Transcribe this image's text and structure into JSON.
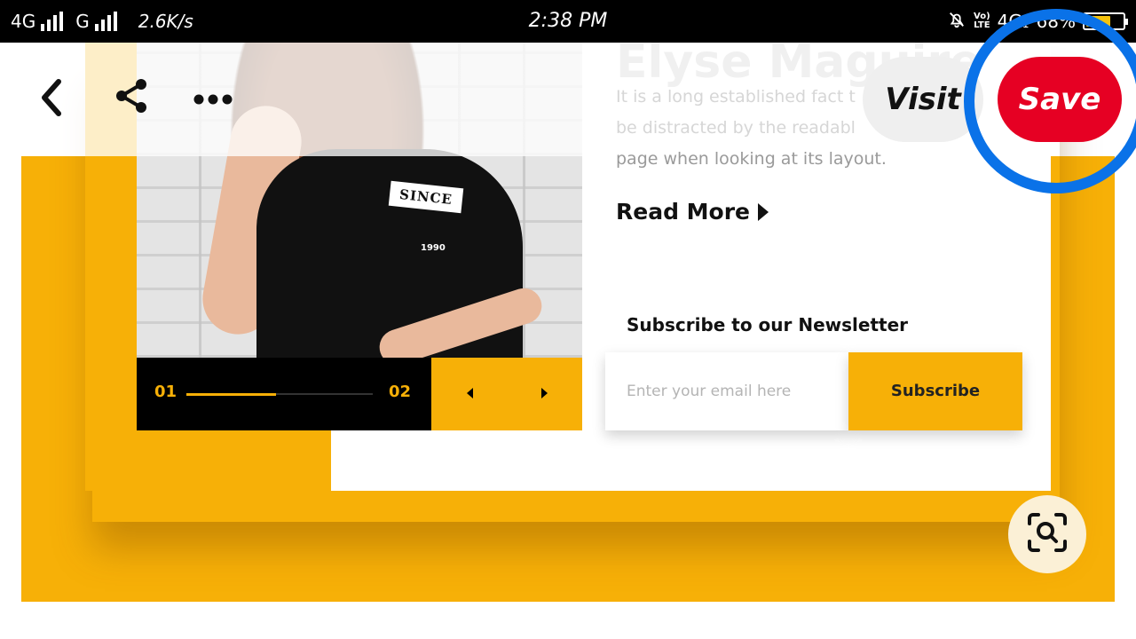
{
  "status_bar": {
    "network1": "4G",
    "network2": "G",
    "speed": "2.6K/s",
    "time": "2:38 PM",
    "volte_top": "Vo)",
    "volte_bottom": "LTE",
    "network3": "4G",
    "network3_sub": "1",
    "battery": "68%",
    "battery_level": 0.68,
    "mute_icon": "bell-slash-icon"
  },
  "toolbar": {
    "back_icon": "chevron-left-icon",
    "share_icon": "share-icon",
    "more_icon": "more-horizontal-icon",
    "visit_label": "Visit",
    "save_label": "Save"
  },
  "pin_image": {
    "title_faded": "Elyse Maguire",
    "body_lines": [
      "It is a long established fact t",
      "be distracted by the readabl",
      "page when looking at its layout."
    ],
    "read_more": "Read More",
    "shirt_text": "SINCE",
    "shirt_year": "1990",
    "slider_start": "01",
    "slider_end": "02",
    "slider_progress": 0.48,
    "newsletter_heading": "Subscribe to our Newsletter",
    "email_placeholder": "Enter your email here",
    "subscribe_label": "Subscribe"
  },
  "visual_search_icon": "lens-search-icon",
  "colors": {
    "accent_yellow": "#f7b007",
    "save_red": "#e60023",
    "highlight_blue": "#0a72e8"
  }
}
